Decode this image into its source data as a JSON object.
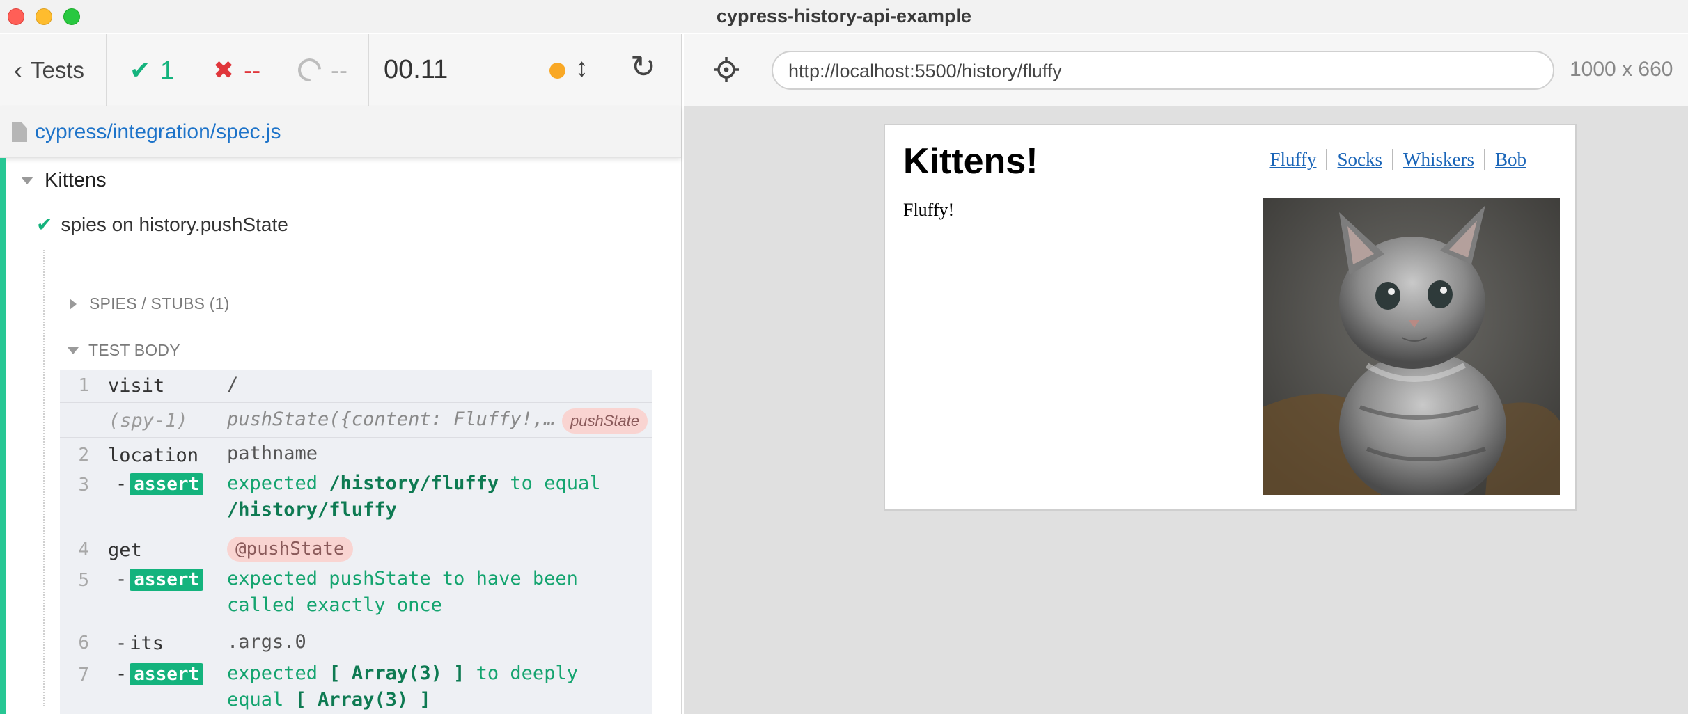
{
  "window": {
    "title": "cypress-history-api-example"
  },
  "reporter": {
    "tests_label": "Tests",
    "passed": "1",
    "failed": "--",
    "pending": "--",
    "duration": "00.11",
    "spec_path": "cypress/integration/spec.js",
    "suite": "Kittens",
    "test": "spies on history.pushState",
    "spies_header": "SPIES / STUBS (1)",
    "body_header": "TEST BODY",
    "commands": [
      {
        "num": "1",
        "name": "visit",
        "message": "/"
      },
      {
        "num": "",
        "name": "(spy-1)",
        "message": "pushState({content: Fluffy!,…",
        "alias": "pushState"
      },
      {
        "num": "2",
        "name": "location",
        "message": "pathname"
      },
      {
        "num": "3",
        "name": "assert",
        "message_parts": [
          "expected",
          "/history/fluffy",
          "to equal",
          "/history/fluffy"
        ]
      },
      {
        "num": "4",
        "name": "get",
        "message": "@pushState"
      },
      {
        "num": "5",
        "name": "assert",
        "message_lines": [
          "expected pushState to have been",
          "called exactly once"
        ]
      },
      {
        "num": "6",
        "name": "its",
        "message": ".args.0"
      },
      {
        "num": "7",
        "name": "assert",
        "message_parts": [
          "expected",
          "[ Array(3) ]",
          "to deeply equal",
          "[ Array(3) ]"
        ]
      }
    ],
    "colors": {
      "pass": "#14b37d",
      "fail": "#e0363b",
      "running": "#f9a825"
    }
  },
  "preview": {
    "url": "http://localhost:5500/history/fluffy",
    "viewport": "1000 x 660",
    "page": {
      "heading": "Kittens!",
      "nav": [
        "Fluffy",
        "Socks",
        "Whiskers",
        "Bob"
      ],
      "text": "Fluffy!",
      "image": "kitten-photo"
    }
  }
}
